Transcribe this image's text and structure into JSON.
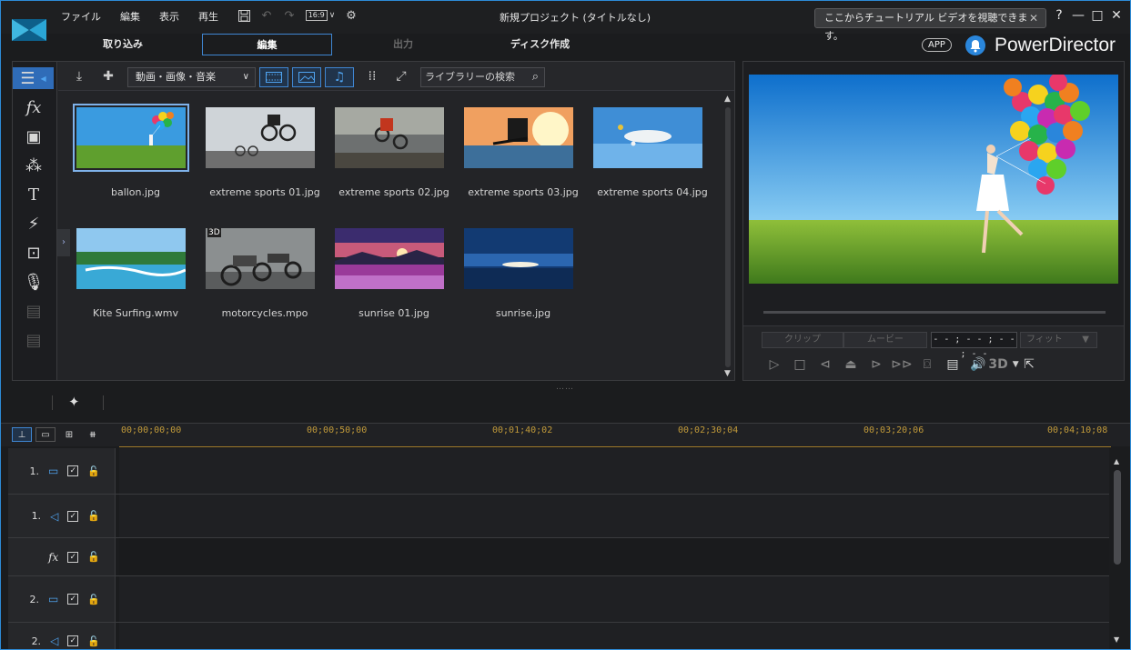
{
  "menu": [
    "ファイル",
    "編集",
    "表示",
    "再生"
  ],
  "toolbar": {
    "aspect": "16:9"
  },
  "window_title": "新規プロジェクト (タイトルなし)",
  "tutorial_tip": "ここからチュートリアル ビデオを視聴できます。",
  "window_controls": {
    "help": "?",
    "minimize": "—",
    "maximize": "□",
    "close": "✕"
  },
  "modes": {
    "capture": "取り込み",
    "edit": "編集",
    "produce": "出力",
    "disc": "ディスク作成"
  },
  "header": {
    "app_badge": "APP",
    "brand": "PowerDirector"
  },
  "library": {
    "filter_combo": "動画・画像・音楽",
    "search_placeholder": "ライブラリーの検索",
    "items": [
      {
        "name": "ballon.jpg",
        "selected": true
      },
      {
        "name": "extreme sports 01.jpg"
      },
      {
        "name": "extreme sports 02.jpg"
      },
      {
        "name": "extreme sports 03.jpg"
      },
      {
        "name": "extreme sports 04.jpg"
      },
      {
        "name": "Kite Surfing.wmv"
      },
      {
        "name": "motorcycles.mpo",
        "badge": "3D"
      },
      {
        "name": "sunrise 01.jpg"
      },
      {
        "name": "sunrise.jpg"
      }
    ]
  },
  "preview": {
    "clip_label": "クリップ",
    "movie_label": "ムービー",
    "timecode": "- - ; - - ; - - ; - -",
    "fit_label": "フィット",
    "three_d": "3D"
  },
  "timeline": {
    "ruler": [
      "00;00;00;00",
      "00;00;50;00",
      "00;01;40;02",
      "00;02;30;04",
      "00;03;20;06",
      "00;04;10;08"
    ],
    "tracks": [
      {
        "num": "1.",
        "type": "video"
      },
      {
        "num": "1.",
        "type": "audio"
      },
      {
        "num": "",
        "type": "fx",
        "label": "fx"
      },
      {
        "num": "2.",
        "type": "video"
      },
      {
        "num": "2.",
        "type": "audio"
      }
    ]
  },
  "colors": {
    "accent": "#3f86d2",
    "background": "#1b1c1e",
    "ruler": "#c19a3a"
  }
}
